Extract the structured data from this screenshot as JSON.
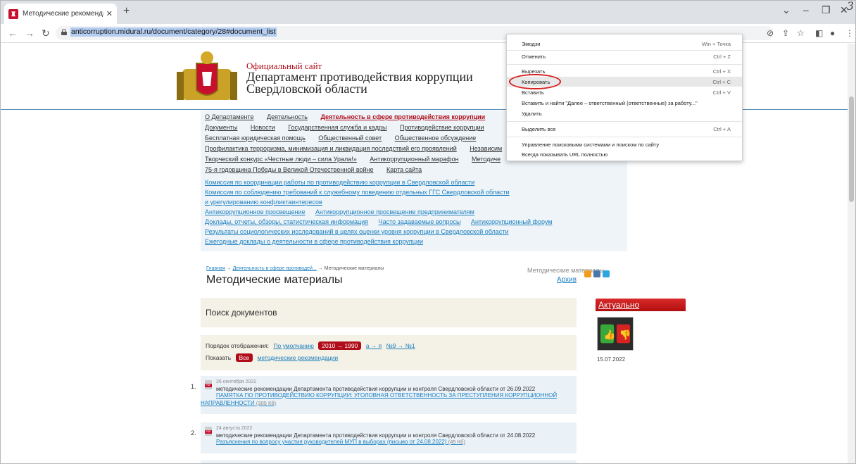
{
  "browser": {
    "tab_title": "Методические рекомендации",
    "url": "anticorruption.midural.ru/document/category/28#document_list",
    "handwriting": "3"
  },
  "site": {
    "pre_title": "Официальный сайт",
    "title": "Департамент противодействия коррупции Свердловской области"
  },
  "nav": {
    "line1": [
      "О Департаменте",
      "Деятельность",
      "Деятельность в сфере противодействия коррупции"
    ],
    "line2": [
      "Документы",
      "Новости",
      "Государственная служба и кадры",
      "Противодействие коррупции"
    ],
    "line3": [
      "Бесплатная юридическая помощь",
      "Общественный совет",
      "Общественное обсуждение"
    ],
    "line4": [
      "Профилактика терроризма, минимизация и ликвидация последствий его проявлений",
      "Независим"
    ],
    "line5": [
      "Творческий конкурс «Честные люди – сила Урала!»",
      "Антикоррупционный марафон",
      "Методиче"
    ],
    "line6": [
      "75-я годовщина Победы в Великой Отечественной войне",
      "Карта сайта"
    ]
  },
  "links": {
    "l1": "Комиссия по координации работы по противодействию коррупции в Свердловской области",
    "l2": "Комиссия по соблюдению требований к служебному поведению отдельных ГГС Свердловской области",
    "l3": "и урегулированию конфликтаинтересов",
    "l4a": "Антикоррупционное просвещение",
    "l4b": "Антикоррупционное просвещение предпринимателям",
    "l5a": "Доклады, отчеты, обзоры, статистическая информация",
    "l5b": "Часто задаваемые вопросы",
    "l5c": "Антикоррупционный форум",
    "l6": "Результаты социологических исследований в целях оценки уровня коррупции в Свердловской области",
    "l7": "Ежегодные доклады о деятельности в сфере противодействия коррупции",
    "section": "Методические материалы"
  },
  "breadcrumb": {
    "home": "Главная",
    "arrow": "→",
    "middle": "Деятельность в сфере противодей...",
    "current": "Методические материалы"
  },
  "main": {
    "title": "Методические материалы",
    "archive": "Архив",
    "search_title": "Поиск документов",
    "order_label": "Порядок отображения:",
    "order_default": "По умолчанию",
    "order_year": "2010 → 1990",
    "order_alpha": "а → я",
    "order_num": "№9 → №1",
    "show_label": "Показать",
    "show_all": "Все",
    "show_filter": "методические рекомендации"
  },
  "docs": [
    {
      "num": "1.",
      "date": "26 сентября 2022",
      "desc": "методические рекомендации Департамента противодействия коррупции и контроля Свердловской области от 26.09.2022",
      "link": "ПАМЯТКА ПО ПРОТИВОДЕЙСТВИЮ КОРРУПЦИИ: УГОЛОВНАЯ ОТВЕТСТВЕННОСТЬ ЗА ПРЕСТУПЛЕНИЯ КОРРУПЦИОННОЙ",
      "link2": "НАПРАВЛЕННОСТИ",
      "size": "(305 Кб)"
    },
    {
      "num": "2.",
      "date": "24 августа 2022",
      "desc": "методические рекомендации Департамента противодействия коррупции и контроля Свердловской области от 24.08.2022",
      "link": "Разъяснения по вопросу участия руководителей МУП в выборах (письмо от 24.08.2022)",
      "size": "(45 Кб)"
    }
  ],
  "aside": {
    "title": "Актуально",
    "date": "15.07.2022"
  },
  "context_menu": {
    "emoji": "Эмодзи",
    "emoji_sc": "Win + Точка",
    "undo": "Отменить",
    "undo_sc": "Ctrl + Z",
    "cut": "Вырезать",
    "cut_sc": "Ctrl + X",
    "copy": "Копировать",
    "copy_sc": "Ctrl + C",
    "paste": "Вставить",
    "paste_sc": "Ctrl + V",
    "paste_search": "Вставить и найти \"Далее – ответственный (ответственные) за работу...\"",
    "delete": "Удалить",
    "select_all": "Выделить все",
    "select_all_sc": "Ctrl + A",
    "manage_search": "Управление поисковыми системами и поиском по сайту",
    "always_url": "Всегда показывать URL полностью"
  },
  "colors": {
    "accent_red": "#b00c1a",
    "link_blue": "#1c7fbf",
    "highlight": "#b4cdf0"
  }
}
